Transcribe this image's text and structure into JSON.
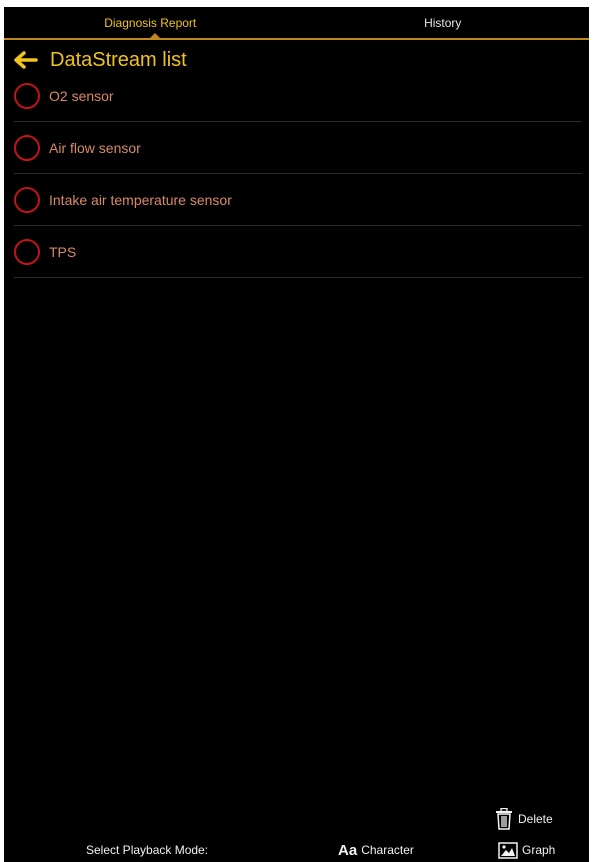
{
  "tabs": [
    {
      "label": "Diagnosis Report",
      "active": true
    },
    {
      "label": "History",
      "active": false
    }
  ],
  "header": {
    "title": "DataStream list"
  },
  "list": {
    "items": [
      {
        "label": "O2 sensor"
      },
      {
        "label": "Air flow sensor"
      },
      {
        "label": "Intake air temperature sensor"
      },
      {
        "label": "TPS"
      }
    ]
  },
  "footer": {
    "delete_label": "Delete",
    "mode_label": "Select Playback Mode:",
    "character_label": "Character",
    "character_icon_text": "Aa",
    "graph_label": "Graph"
  },
  "colors": {
    "accent": "#f0c419",
    "radio_ring": "#c0141b",
    "item_text": "#d98a6a",
    "background": "#000000"
  },
  "icons": {
    "back": "arrow-left-icon",
    "delete": "trash-icon",
    "character": "text-aa-icon",
    "graph": "image-graph-icon"
  }
}
